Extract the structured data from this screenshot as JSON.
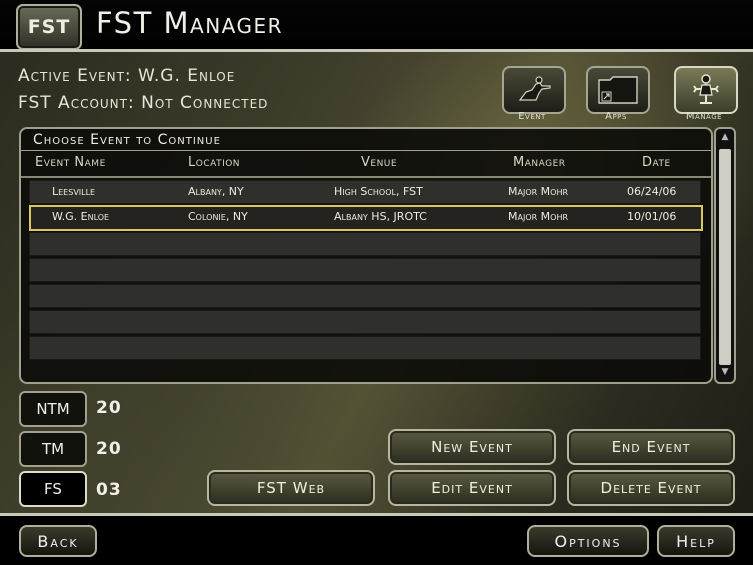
{
  "app": {
    "logo": "FST",
    "title": "FST Manager"
  },
  "info": {
    "active_event": "Active Event: W.G. Enloe",
    "account": "FST Account: Not Connected"
  },
  "nav": [
    {
      "label": "Event",
      "icon": "soldier-icon"
    },
    {
      "label": "Apps",
      "icon": "folder-shortcut-icon"
    },
    {
      "label": "Manage",
      "icon": "manage-icon",
      "active": true
    }
  ],
  "panel": {
    "title": "Choose Event to Continue",
    "columns": [
      "Event Name",
      "Location",
      "Venue",
      "Manager",
      "Date"
    ],
    "rows": [
      [
        "Leesville",
        "Albany, NY",
        "High School, FST",
        "Major Mohr",
        "06/24/06"
      ],
      [
        "W.G. Enloe",
        "Colonie, NY",
        "Albany HS, JROTC",
        "Major Mohr",
        "10/01/06"
      ]
    ],
    "selected_row": 1
  },
  "counts": [
    {
      "label": "NTM",
      "value": "20"
    },
    {
      "label": "TM",
      "value": "20"
    },
    {
      "label": "FS",
      "value": "03",
      "active": true
    }
  ],
  "buttons": {
    "fst_web": "FST Web",
    "new_event": "New Event",
    "edit_event": "Edit Event",
    "end_event": "End Event",
    "delete_event": "Delete Event"
  },
  "bottom": {
    "back": "Back",
    "options": "Options",
    "help": "Help"
  },
  "colors": {
    "selected_border": "#d8c860",
    "frame": "#c9c9b8"
  }
}
